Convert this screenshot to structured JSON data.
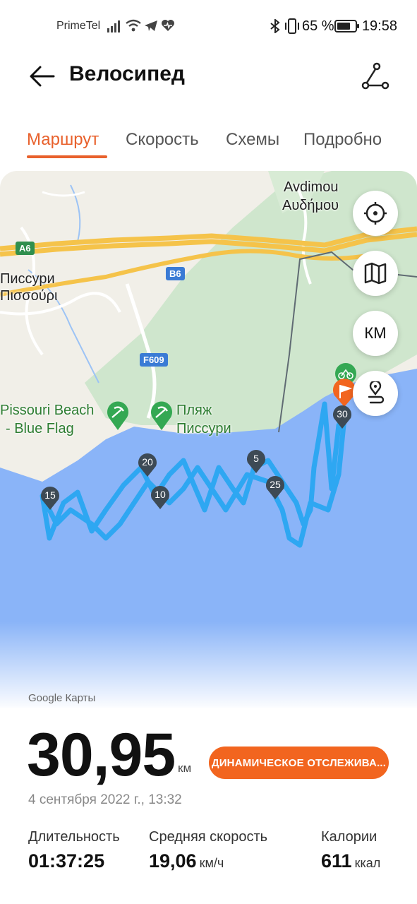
{
  "status_bar": {
    "carrier": "PrimeTel",
    "battery_percent": "65 %",
    "time": "19:58"
  },
  "header": {
    "title": "Велосипед",
    "back_icon": "arrow-left-icon",
    "route_icon": "route-share-icon"
  },
  "tabs": [
    {
      "label": "Маршрут",
      "active": true
    },
    {
      "label": "Скорость",
      "active": false
    },
    {
      "label": "Схемы",
      "active": false
    },
    {
      "label": "Подробно",
      "active": false
    }
  ],
  "map": {
    "places": {
      "avdimou": "Avdimou",
      "avdimou_gr": "Αυδήμου",
      "pissouri": "Писсури",
      "pissouri_gr": "Πισσούρι",
      "pissouri_beach_1": "Pissouri Beach",
      "pissouri_beach_2": "- Blue Flag",
      "beach_ru_1": "Пляж",
      "beach_ru_2": "Писсури"
    },
    "roads": {
      "a6": "A6",
      "b6": "B6",
      "f609": "F609"
    },
    "km_markers": [
      "5",
      "10",
      "15",
      "20",
      "25",
      "30"
    ],
    "controls": {
      "locate_icon": "crosshair-icon",
      "map_type_icon": "map-icon",
      "unit_label": "КМ",
      "route_icon": "route-pin-icon"
    },
    "colors": {
      "sea": "#8ab4f8",
      "land": "#f1efe8",
      "park": "#cde8cf",
      "highway": "#f5c34a",
      "track": "#2ea7f2",
      "start": "#34a853",
      "finish": "#f2651f"
    },
    "attribution": "Google Карты"
  },
  "summary": {
    "distance": "30,95",
    "distance_unit": "км",
    "tracking_button": "ДИНАМИЧЕСКОЕ ОТСЛЕЖИВА...",
    "date": "4 сентября 2022 г., 13:32"
  },
  "stats": {
    "duration_label": "Длительность",
    "duration_value": "01:37:25",
    "avg_speed_label": "Средняя скорость",
    "avg_speed_value": "19,06",
    "avg_speed_unit": "км/ч",
    "calories_label": "Калории",
    "calories_value": "611",
    "calories_unit": "ккал"
  }
}
